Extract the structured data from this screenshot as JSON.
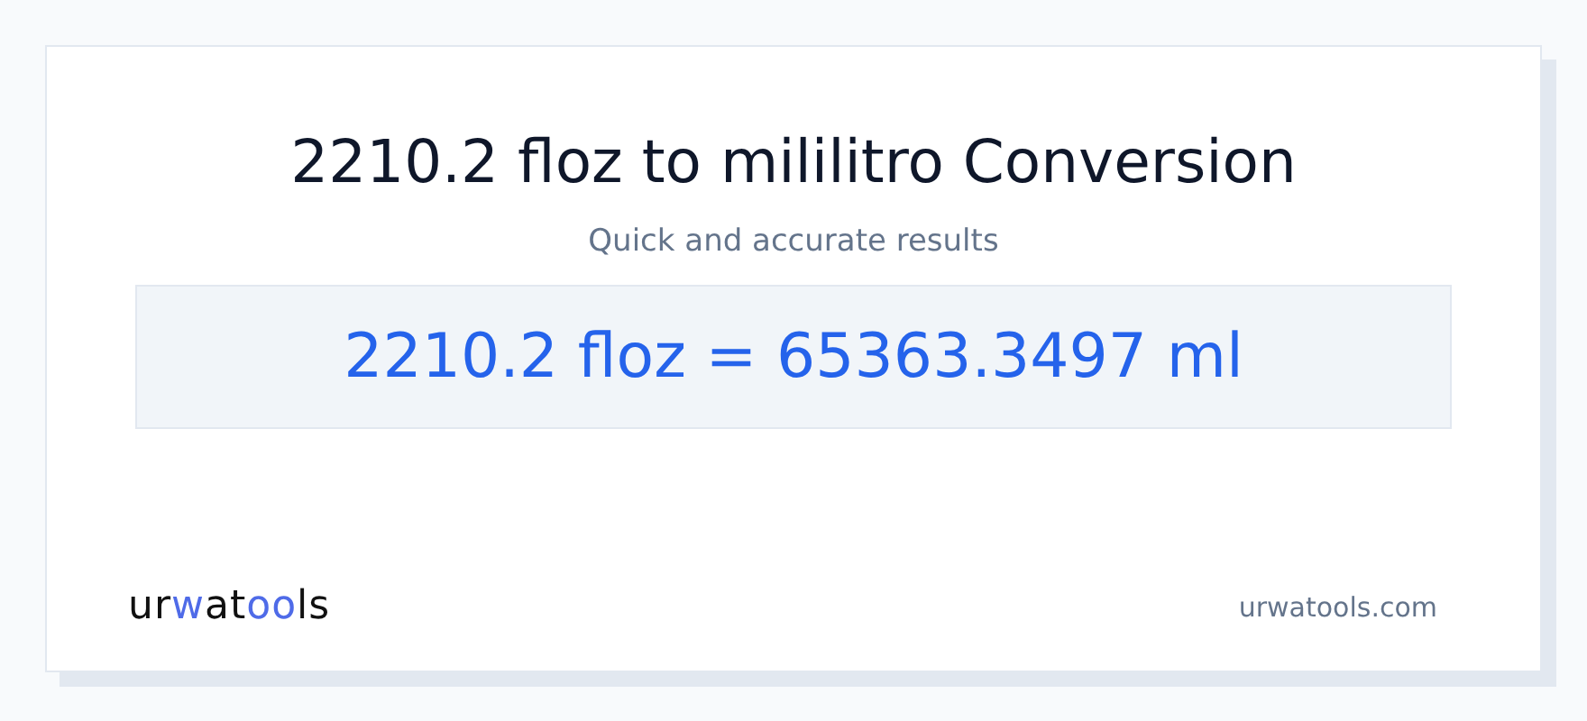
{
  "title": "2210.2 floz to mililitro Conversion",
  "subtitle": "Quick and accurate results",
  "result": "2210.2 floz = 65363.3497 ml",
  "logo": [
    {
      "text": "ur",
      "accent": false
    },
    {
      "text": "w",
      "accent": true
    },
    {
      "text": "at",
      "accent": false
    },
    {
      "text": "oo",
      "accent": true
    },
    {
      "text": "ls",
      "accent": false
    }
  ],
  "site": "urwatools.com"
}
